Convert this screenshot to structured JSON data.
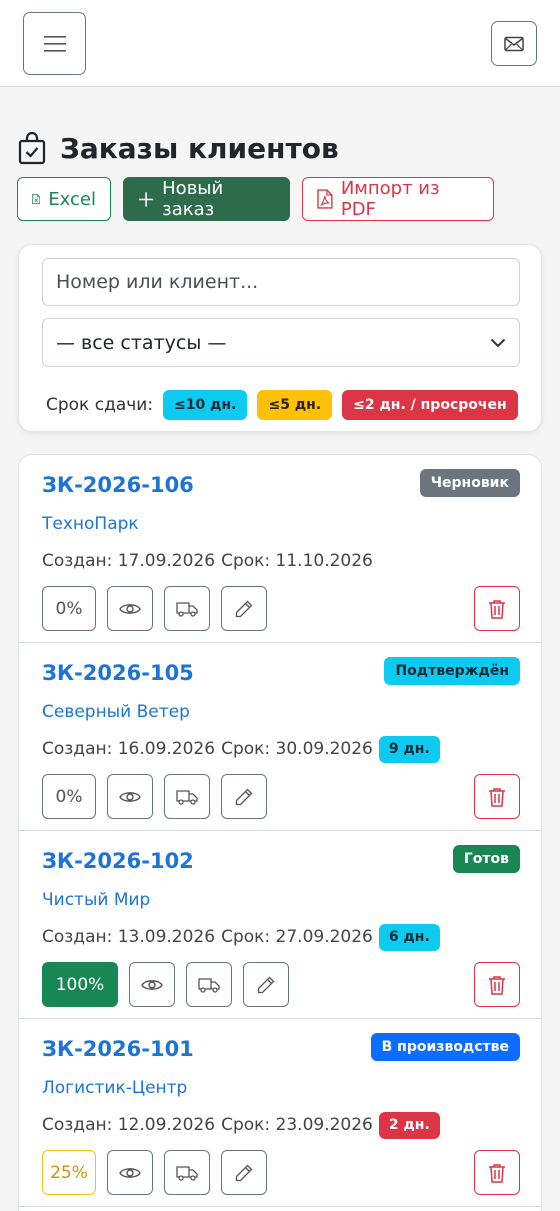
{
  "header": {
    "menu_icon": "hamburger-icon",
    "mail_icon": "envelope-icon"
  },
  "page": {
    "title": "Заказы клиентов",
    "title_icon": "shopping-bag-check-icon"
  },
  "actions": {
    "excel_label": "Excel",
    "new_order_label": "Новый заказ",
    "import_pdf_label": "Импорт из PDF"
  },
  "filters": {
    "search_placeholder": "Номер или клиент...",
    "status_selected": "— все статусы —",
    "deadline_label": "Срок сдачи:",
    "chips": [
      "≤10 дн.",
      "≤5 дн.",
      "≤2 дн. / просрочен"
    ]
  },
  "colors": {
    "accent": "#2e6b4b",
    "link": "#1e74d6",
    "success": "#198754",
    "danger": "#dc3545",
    "warning": "#ffc107",
    "info": "#0dcaf0",
    "secondary": "#6c757d",
    "primary": "#0d6efd"
  },
  "orders": [
    {
      "number": "ЗК-2026-106",
      "status": "Черновик",
      "client": "ТехноПарк",
      "created": "Создан: 17.09.2026",
      "deadline": "Срок: 11.10.2026",
      "days_left": "",
      "progress": "0%"
    },
    {
      "number": "ЗК-2026-105",
      "status": "Подтверждён",
      "client": "Северный Ветер",
      "created": "Создан: 16.09.2026",
      "deadline": "Срок: 30.09.2026",
      "days_left": "9 дн.",
      "progress": "0%"
    },
    {
      "number": "ЗК-2026-102",
      "status": "Готов",
      "client": "Чистый Мир",
      "created": "Создан: 13.09.2026",
      "deadline": "Срок: 27.09.2026",
      "days_left": "6 дн.",
      "progress": "100%"
    },
    {
      "number": "ЗК-2026-101",
      "status": "В производстве",
      "client": "Логистик-Центр",
      "created": "Создан: 12.09.2026",
      "deadline": "Срок: 23.09.2026",
      "days_left": "2 дн.",
      "progress": "25%"
    }
  ]
}
